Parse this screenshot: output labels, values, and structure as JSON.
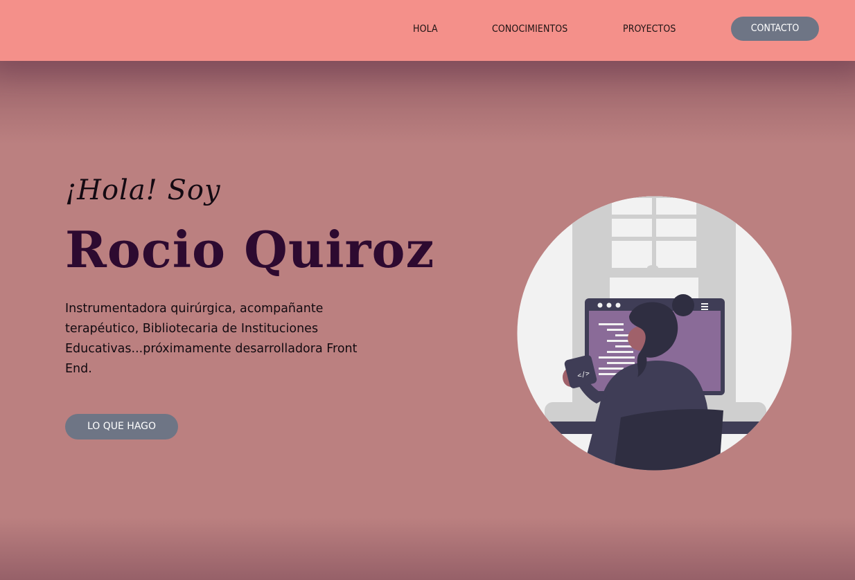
{
  "nav": {
    "links": [
      "HOLA",
      "CONOCIMIENTOS",
      "PROYECTOS"
    ],
    "contact_label": "CONTACTO"
  },
  "hero": {
    "greeting": "¡Hola! Soy",
    "name": "Rocio Quiroz",
    "bio": "Instrumentadora quirúrgica, acompañante terapéutico, Bibliotecaria de Instituciones Educativas...próximamente desarrolladora Front End.",
    "cta_label": "LO QUE HAGO",
    "illustration_icon": "woman-coding-illustration"
  },
  "colors": {
    "navbar": "#f4908a",
    "background": "#bb8080",
    "button": "#6e7585",
    "name": "#2d0a30"
  }
}
